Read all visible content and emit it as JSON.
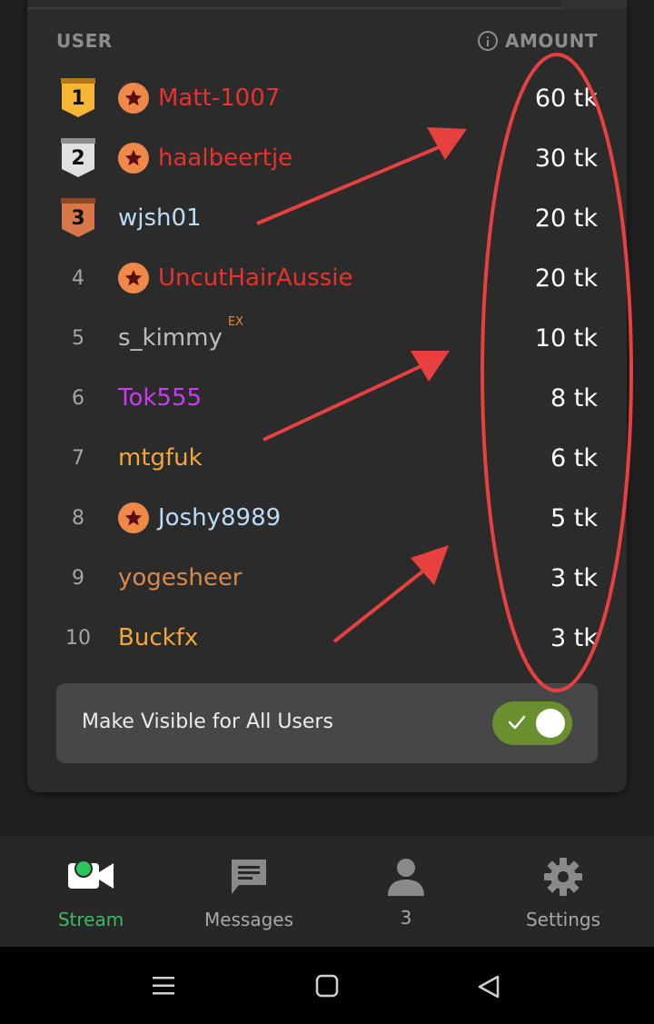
{
  "leaderboard": {
    "header_user": "USER",
    "header_amount": "AMOUNT",
    "rows": [
      {
        "rank": "1",
        "name": "Matt-1007",
        "name_color": "#e8322f",
        "star": true,
        "medal": "gold",
        "amount": "60 tk"
      },
      {
        "rank": "2",
        "name": "haalbeertje",
        "name_color": "#e8322f",
        "star": true,
        "medal": "silver",
        "amount": "30 tk"
      },
      {
        "rank": "3",
        "name": "wjsh01",
        "name_color": "#bcdcf6",
        "star": false,
        "medal": "bronze",
        "amount": "20 tk"
      },
      {
        "rank": "4",
        "name": "UncutHairAussie",
        "name_color": "#e8322f",
        "star": true,
        "medal": "",
        "amount": "20 tk"
      },
      {
        "rank": "5",
        "name": "s_kimmy",
        "name_color": "#bdbdbd",
        "star": false,
        "medal": "",
        "amount": "10 tk",
        "superscript": "EX"
      },
      {
        "rank": "6",
        "name": "Tok555",
        "name_color": "#c93cf0",
        "star": false,
        "medal": "",
        "amount": "8 tk"
      },
      {
        "rank": "7",
        "name": "mtgfuk",
        "name_color": "#f3a73a",
        "star": false,
        "medal": "",
        "amount": "6 tk"
      },
      {
        "rank": "8",
        "name": "Joshy8989",
        "name_color": "#bcdcf6",
        "star": true,
        "medal": "",
        "amount": "5 tk"
      },
      {
        "rank": "9",
        "name": "yogesheer",
        "name_color": "#d98a4a",
        "star": false,
        "medal": "",
        "amount": "3 tk"
      },
      {
        "rank": "10",
        "name": "Buckfx",
        "name_color": "#f3a73a",
        "star": false,
        "medal": "",
        "amount": "3 tk"
      }
    ]
  },
  "visibility": {
    "label": "Make Visible for All Users",
    "enabled": true
  },
  "nav": {
    "items": [
      {
        "label": "Stream",
        "icon": "video-camera-icon",
        "active": true
      },
      {
        "label": "Messages",
        "icon": "message-icon",
        "active": false
      },
      {
        "label": "3",
        "icon": "person-icon",
        "active": false
      },
      {
        "label": "Settings",
        "icon": "gear-icon",
        "active": false
      }
    ]
  },
  "colors": {
    "accent_green": "#3dba63",
    "toggle_on": "#6a8f2f",
    "annotation_red": "#e84040"
  }
}
